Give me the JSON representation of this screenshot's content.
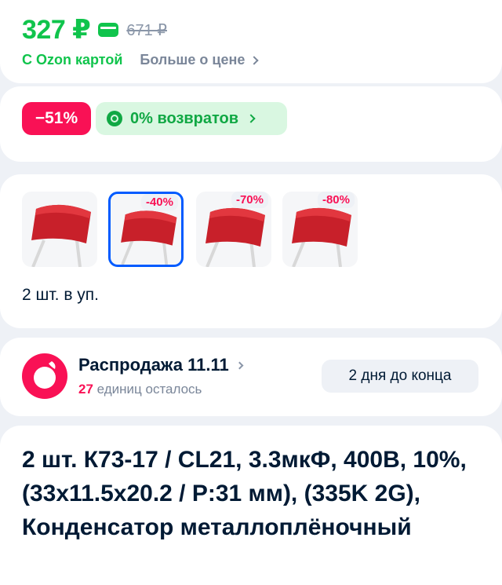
{
  "price": {
    "current": "327 ₽",
    "old": "671 ₽",
    "ozon_card_label": "С Ozon картой",
    "more_about_price": "Больше о цене"
  },
  "badges": {
    "discount": "−51%",
    "returns": "0% возвратов"
  },
  "variants": {
    "items": [
      {
        "badge": ""
      },
      {
        "badge": "-40%"
      },
      {
        "badge": "-70%"
      },
      {
        "badge": "-80%"
      }
    ],
    "pack_info": "2 шт. в уп."
  },
  "sale": {
    "title": "Распродажа 11.11",
    "remaining_count": "27",
    "remaining_text": " единиц осталось",
    "days_left": "2 дня до конца"
  },
  "product": {
    "title": "2 шт. К73-17 / CL21, 3.3мкФ, 400В, 10%, (33x11.5x20.2 / P:31 мм), (335K 2G), Конденсатор металлоплёночный"
  },
  "colors": {
    "ozon_green": "#10c44c",
    "discount_red": "#f91155",
    "selected_blue": "#005bff"
  }
}
